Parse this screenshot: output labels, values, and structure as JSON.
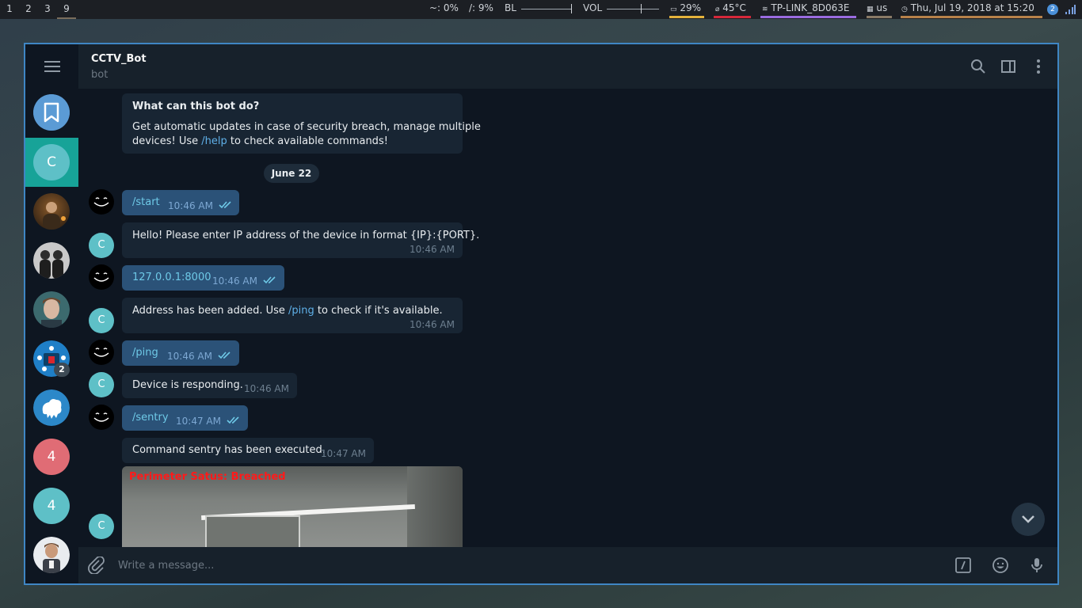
{
  "topbar": {
    "workspaces": [
      "1",
      "2",
      "3",
      "9"
    ],
    "home": "~: 0%",
    "root": "/: 9%",
    "bl_label": "BL",
    "vol_label": "VOL",
    "battery": "29%",
    "temp": "45°C",
    "wifi": "TP-LINK_8D063E",
    "kbd": "us",
    "datetime": "Thu, Jul 19, 2018 at 15:20",
    "notif_count": "2"
  },
  "chat_list": {
    "active_initial": "C",
    "items": [
      {
        "icon": "bookmark-icon"
      },
      {
        "initial": "C"
      },
      {
        "icon": "avatar-photo"
      },
      {
        "icon": "avatar-photo"
      },
      {
        "icon": "avatar-photo"
      },
      {
        "icon": "avatar-robot",
        "badge": "2"
      },
      {
        "icon": "avatar-cloud"
      },
      {
        "initial": "4",
        "color": "#e06c75"
      },
      {
        "initial": "4",
        "color": "#5ec0c7"
      },
      {
        "icon": "avatar-photo"
      }
    ]
  },
  "header": {
    "title": "CCTV_Bot",
    "subtitle": "bot"
  },
  "bot_info": {
    "heading": "What can this bot do?",
    "line1": "Get automatic updates in case of security breach, manage multiple",
    "line2_pre": "devices! Use ",
    "line2_cmd": "/help",
    "line2_post": " to check available commands!"
  },
  "date_divider": "June 22",
  "messages": [
    {
      "from": "me",
      "text": "/start",
      "time": "10:46 AM"
    },
    {
      "from": "bot",
      "avatar": "C",
      "text": "Hello! Please enter IP address of the device in format {IP}:{PORT}.",
      "time": "10:46 AM"
    },
    {
      "from": "me",
      "text": "127.0.0.1:8000",
      "time": "10:46 AM"
    },
    {
      "from": "bot",
      "avatar": "C",
      "text_pre": "Address has been added. Use ",
      "text_cmd": "/ping",
      "text_post": " to check if it's available.",
      "time": "10:46 AM"
    },
    {
      "from": "me",
      "text": "/ping",
      "time": "10:46 AM"
    },
    {
      "from": "bot",
      "avatar": "C",
      "text": "Device is responding.",
      "time": "10:46 AM"
    },
    {
      "from": "me",
      "text": "/sentry",
      "time": "10:47 AM"
    },
    {
      "from": "bot",
      "text": "Command sentry has been executed.",
      "time": "10:47 AM"
    },
    {
      "from": "bot",
      "avatar": "C",
      "photo_caption": "Perimeter Satus: Breached"
    }
  ],
  "composer": {
    "placeholder": "Write a message..."
  },
  "colors": {
    "accent": "#17a398",
    "window_border": "#3f86c4",
    "bubble_out": "#2b5278",
    "bubble_in": "#182533"
  }
}
